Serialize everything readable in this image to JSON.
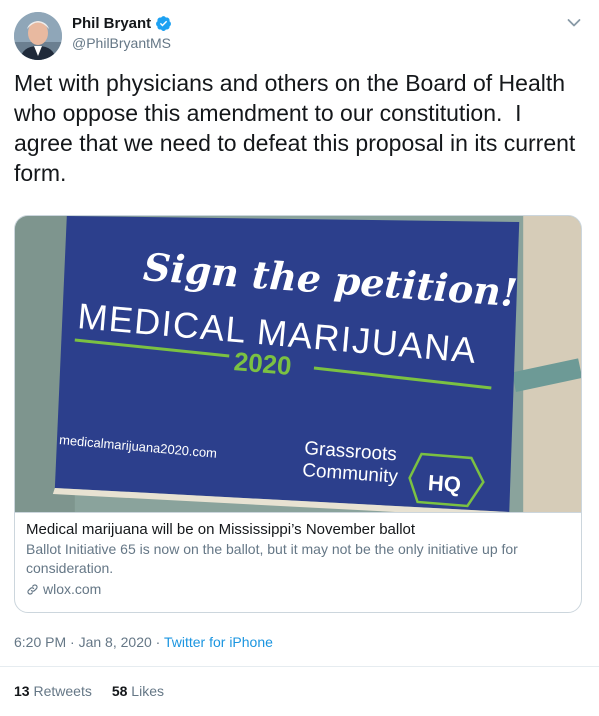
{
  "author": {
    "name": "Phil Bryant",
    "handle": "@PhilBryantMS",
    "verified": true
  },
  "tweet": {
    "text": "Met with physicians and others on the Board of Health who oppose this amendment to our constitution.  I agree that we need to defeat this proposal in its current form."
  },
  "card": {
    "image": {
      "headline": "Sign the petition!",
      "sign_title": "MEDICAL MARIJUANA",
      "sign_year": "2020",
      "sign_url": "medicalmarijuana2020.com",
      "org_line1": "Grassroots",
      "org_line2": "Community",
      "org_badge": "HQ"
    },
    "title": "Medical marijuana will be on Mississippi’s November ballot",
    "description": "Ballot Initiative 65 is now on the ballot, but it may not be the only initiative up for consideration.",
    "domain": "wlox.com"
  },
  "meta": {
    "time": "6:20 PM",
    "separator": "·",
    "date": "Jan 8, 2020",
    "source": "Twitter for iPhone"
  },
  "stats": {
    "retweets_count": "13",
    "retweets_label": "Retweets",
    "likes_count": "58",
    "likes_label": "Likes"
  },
  "colors": {
    "link": "#1b95e0",
    "secondary_text": "#657786",
    "sign_blue": "#2c3f8c",
    "sign_green": "#7bc142"
  },
  "icons": {
    "verified": "verified-badge-icon",
    "caret": "chevron-down-icon",
    "link": "link-icon"
  }
}
